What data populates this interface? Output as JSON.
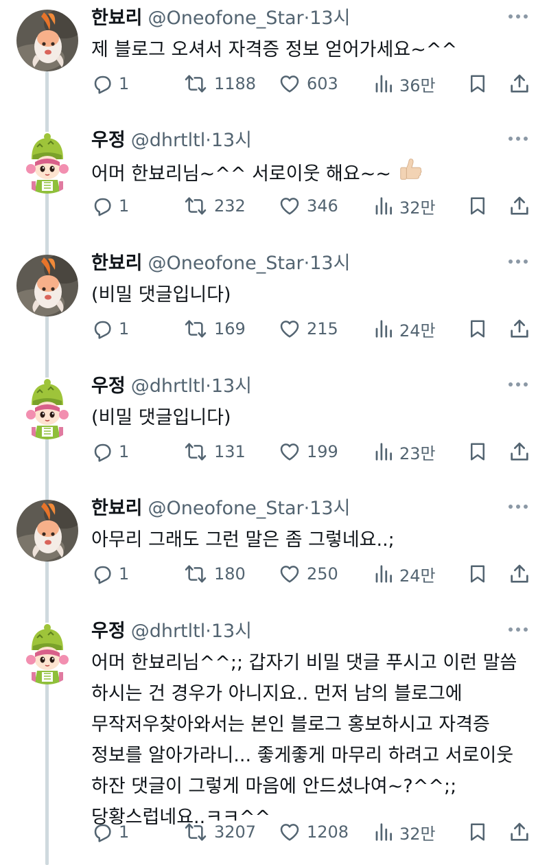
{
  "tweets": [
    {
      "name": "한뵤리",
      "handle": "@Oneofone_Star",
      "dot": "·",
      "time": "13시",
      "text": "제 블로그 오셔서 자격증 정보 얻어가세요~^^",
      "replies": "1",
      "retweets": "1188",
      "likes": "603",
      "views": "36만",
      "avatar": "goldfish-avatar"
    },
    {
      "name": "우정",
      "handle": "@dhrtltl",
      "dot": "·",
      "time": "13시",
      "text": "어머 한뵤리님~^^ 서로이웃 해요~~",
      "emoji": "thumbs-up-icon",
      "replies": "1",
      "retweets": "232",
      "likes": "346",
      "views": "32만",
      "avatar": "cartoon-girl-avatar"
    },
    {
      "name": "한뵤리",
      "handle": "@Oneofone_Star",
      "dot": "·",
      "time": "13시",
      "text": "(비밀 댓글입니다)",
      "replies": "1",
      "retweets": "169",
      "likes": "215",
      "views": "24만",
      "avatar": "goldfish-avatar"
    },
    {
      "name": "우정",
      "handle": "@dhrtltl",
      "dot": "·",
      "time": "13시",
      "text": "(비밀 댓글입니다)",
      "replies": "1",
      "retweets": "131",
      "likes": "199",
      "views": "23만",
      "avatar": "cartoon-girl-avatar"
    },
    {
      "name": "한뵤리",
      "handle": "@Oneofone_Star",
      "dot": "·",
      "time": "13시",
      "text": "아무리 그래도 그런 말은 좀 그렇네요..;",
      "replies": "1",
      "retweets": "180",
      "likes": "250",
      "views": "24만",
      "avatar": "goldfish-avatar"
    },
    {
      "name": "우정",
      "handle": "@dhrtltl",
      "dot": "·",
      "time": "13시",
      "text": "어머 한뵤리님^^;; 갑자기 비밀 댓글 푸시고 이런 말씀 하시는 건 경우가 아니지요.. 먼저 남의 블로그에 무작저우찾아와서는 본인 블로그 홍보하시고 자격증 정보를 알아가라니... 좋게좋게 마무리 하려고 서로이웃 하잔 댓글이 그렇게 마음에 안드셨나여~?^^;; 당황스럽네요..ㅋㅋ^^",
      "replies": "1",
      "retweets": "3207",
      "likes": "1208",
      "views": "32만",
      "avatar": "cartoon-girl-avatar"
    }
  ],
  "colors": {
    "text": "#0f1419",
    "muted": "#536471",
    "thread_line": "#cfd9de"
  }
}
